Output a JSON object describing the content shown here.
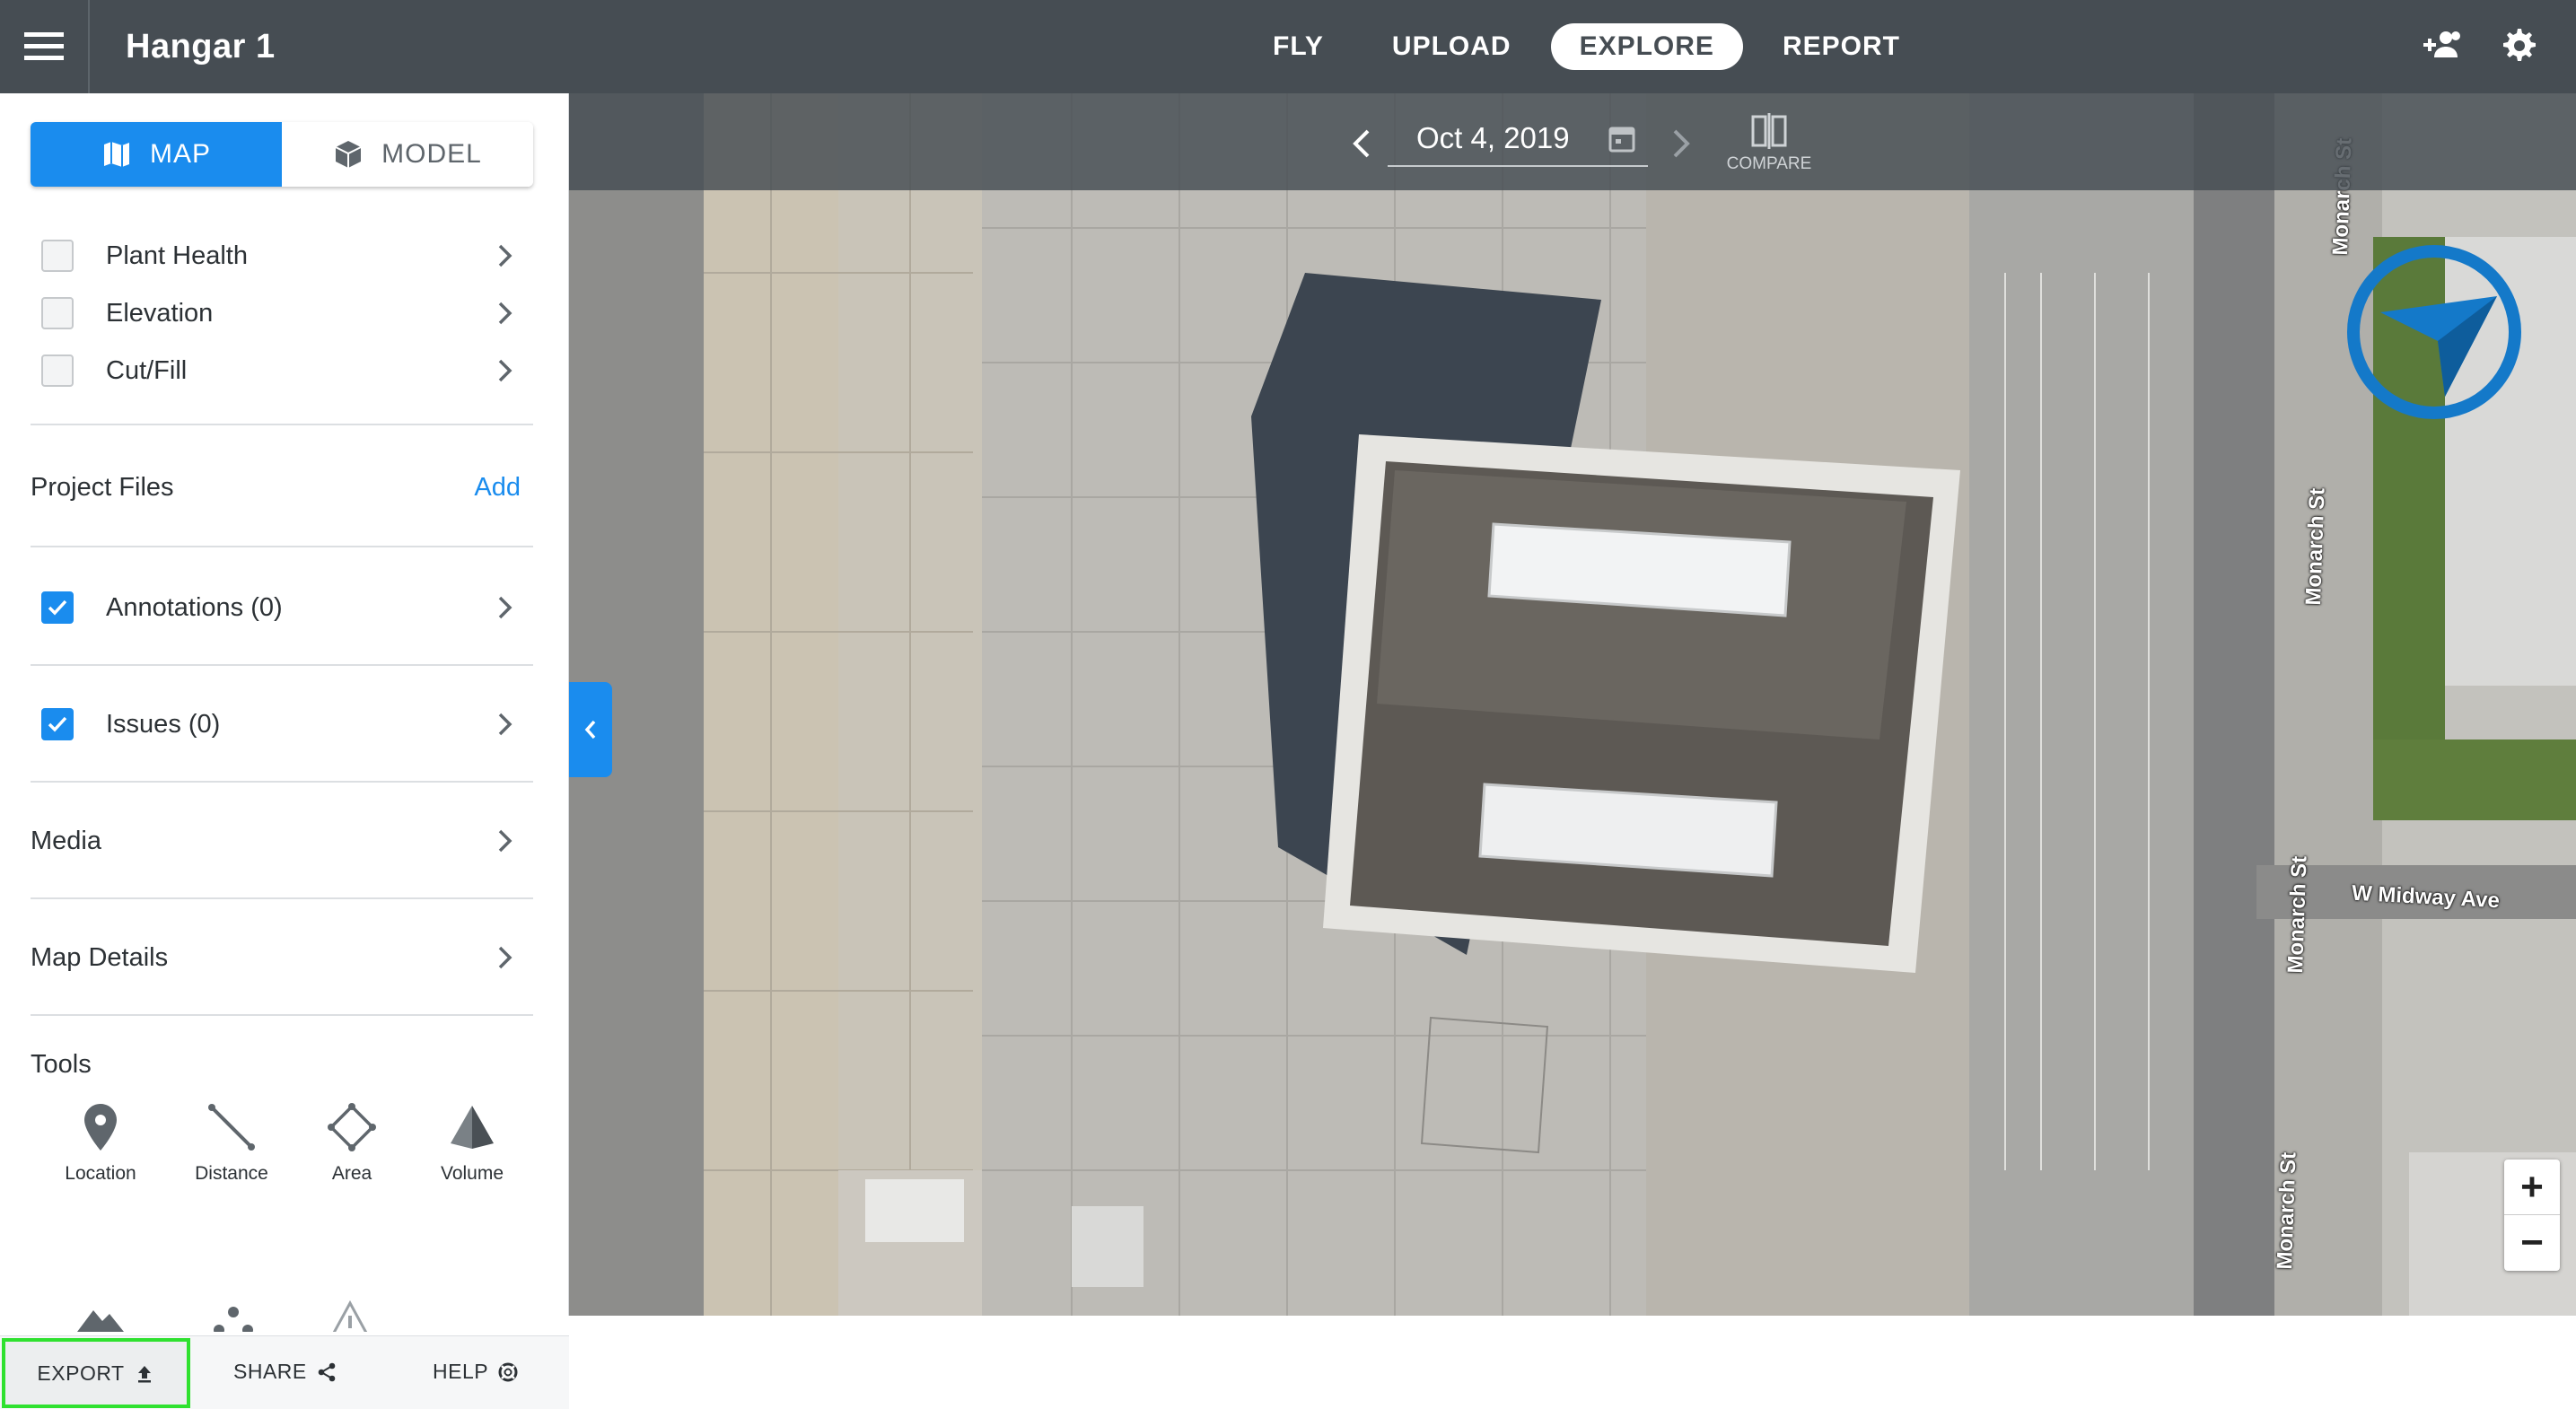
{
  "header": {
    "title": "Hangar 1",
    "tabs": [
      {
        "label": "FLY"
      },
      {
        "label": "UPLOAD"
      },
      {
        "label": "EXPLORE"
      },
      {
        "label": "REPORT"
      }
    ],
    "active_tab": "EXPLORE",
    "icons": [
      "add-user-icon",
      "gear-icon"
    ]
  },
  "sidebar": {
    "view_toggle": {
      "map_label": "MAP",
      "model_label": "MODEL",
      "selected": "MAP"
    },
    "layers": [
      {
        "label": "Plant Health",
        "checked": false
      },
      {
        "label": "Elevation",
        "checked": false
      },
      {
        "label": "Cut/Fill",
        "checked": false
      }
    ],
    "project_files": {
      "label": "Project Files",
      "add_label": "Add"
    },
    "annotations": {
      "label": "Annotations (0)",
      "checked": true
    },
    "issues": {
      "label": "Issues (0)",
      "checked": true
    },
    "media": {
      "label": "Media"
    },
    "map_details": {
      "label": "Map Details"
    },
    "tools": {
      "label": "Tools",
      "items": [
        {
          "label": "Location",
          "icon": "pin-icon"
        },
        {
          "label": "Distance",
          "icon": "ruler-line-icon"
        },
        {
          "label": "Area",
          "icon": "polygon-icon"
        },
        {
          "label": "Volume",
          "icon": "pyramid-icon"
        }
      ]
    },
    "footer": {
      "export_label": "EXPORT",
      "share_label": "SHARE",
      "help_label": "HELP"
    }
  },
  "map": {
    "date": "Oct 4, 2019",
    "compare_label": "COMPARE",
    "streets": [
      {
        "label": "Monarch St"
      },
      {
        "label": "Monarch St"
      },
      {
        "label": "Monarch St"
      },
      {
        "label": "Monarch St"
      },
      {
        "label": "W Midway Ave"
      }
    ],
    "zoom_in": "+",
    "zoom_out": "−"
  },
  "colors": {
    "accent": "#1a8cee",
    "topbar": "#464d53",
    "highlight": "#2fe12f"
  }
}
